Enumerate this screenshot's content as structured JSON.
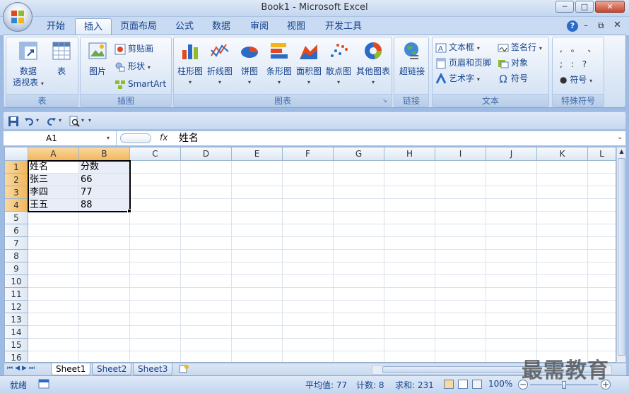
{
  "window": {
    "title": "Book1 - Microsoft Excel",
    "minimize": "─",
    "restore": "□",
    "close": "✕"
  },
  "tabs": [
    "开始",
    "插入",
    "页面布局",
    "公式",
    "数据",
    "审阅",
    "视图",
    "开发工具"
  ],
  "active_tab": "插入",
  "ribbon_right": {
    "help": "?",
    "min": "–",
    "restore": "⧉",
    "close": "✕"
  },
  "groups": {
    "table": {
      "label": "表",
      "pivot_line1": "数据",
      "pivot_line2": "透视表",
      "table": "表"
    },
    "illustrations": {
      "label": "插图",
      "picture": "图片",
      "clipart": "剪贴画",
      "shapes": "形状",
      "smartart": "SmartArt"
    },
    "charts": {
      "label": "图表",
      "items": [
        "柱形图",
        "折线图",
        "饼图",
        "条形图",
        "面积图",
        "散点图",
        "其他图表"
      ]
    },
    "links": {
      "label": "链接",
      "hyperlink": "超链接"
    },
    "text": {
      "label": "文本",
      "textbox": "文本框",
      "header_footer": "页眉和页脚",
      "wordart": "艺术字",
      "signature": "签名行",
      "object": "对象",
      "symbol": "符号"
    },
    "special": {
      "label": "特殊符号",
      "row1": ",  。 、",
      "row2": ";  :  ?",
      "symbol": "符号"
    }
  },
  "formula_bar": {
    "name_box": "A1",
    "fx": "fx",
    "value": "姓名"
  },
  "columns": [
    "A",
    "B",
    "C",
    "D",
    "E",
    "F",
    "G",
    "H",
    "I",
    "J",
    "K",
    "L"
  ],
  "rows": [
    "1",
    "2",
    "3",
    "4",
    "5",
    "6",
    "7",
    "8",
    "9",
    "10",
    "11",
    "12",
    "13",
    "14",
    "15",
    "16"
  ],
  "cells": [
    [
      "姓名",
      "分数"
    ],
    [
      "张三",
      "66"
    ],
    [
      "李四",
      "77"
    ],
    [
      "王五",
      "88"
    ]
  ],
  "sheets": [
    "Sheet1",
    "Sheet2",
    "Sheet3"
  ],
  "status": {
    "ready": "就绪",
    "average": "平均值: 77",
    "count": "计数: 8",
    "sum": "求和: 231",
    "zoom": "100%"
  },
  "watermark": "最需教育",
  "colors": {
    "accent": "#15428b",
    "selection_header": "#f1b65d",
    "ribbon_bg": "#dde8f6"
  }
}
